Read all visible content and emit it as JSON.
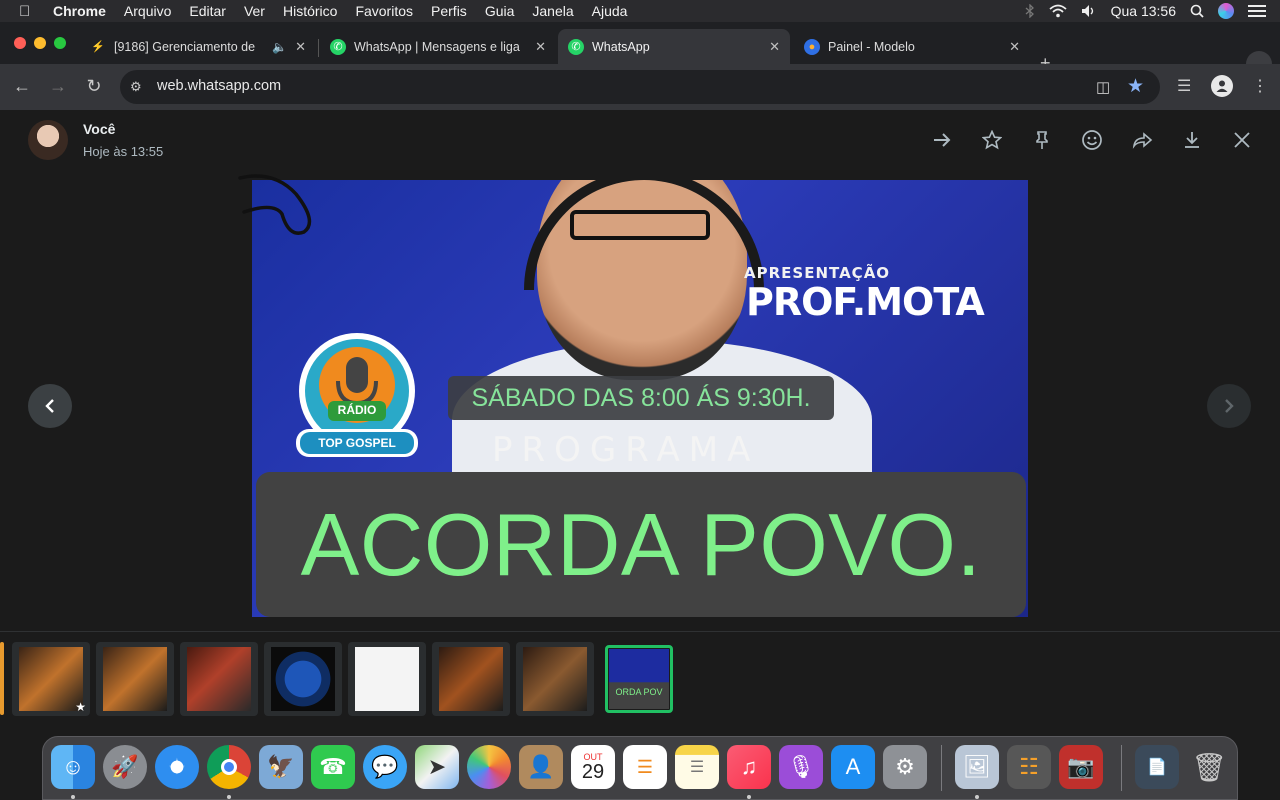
{
  "menubar": {
    "app": "Chrome",
    "items": [
      "Arquivo",
      "Editar",
      "Ver",
      "Histórico",
      "Favoritos",
      "Perfis",
      "Guia",
      "Janela",
      "Ajuda"
    ],
    "clock": "Qua 13:56"
  },
  "tabs": [
    {
      "title": "[9186] Gerenciamento de",
      "active": false
    },
    {
      "title": "WhatsApp | Mensagens e liga",
      "active": false
    },
    {
      "title": "WhatsApp",
      "active": true
    },
    {
      "title": "Painel - Modelo",
      "active": false
    }
  ],
  "toolbar": {
    "url": "web.whatsapp.com"
  },
  "viewer": {
    "sender": "Você",
    "timestamp": "Hoje às 13:55"
  },
  "image": {
    "apresentacao": "APRESENTAÇÃO",
    "name": "PROF.MOTA",
    "logo_radio": "RÁDIO",
    "logo_top": "TOP GOSPEL",
    "schedule": "SÁBADO DAS 8:00 ÁS 9:30H.",
    "programa": "PROGRAMA",
    "headline": "ACORDA POVO."
  },
  "thumbnails": {
    "count": 8,
    "selected_index": 7,
    "selected_caption": "ORDA POV"
  },
  "colors": {
    "whatsapp_green": "#21c063",
    "headline_green": "#7ff08a",
    "accent_blue": "#8ab4f8"
  },
  "dock": {
    "calendar_month": "OUT",
    "calendar_day": "29"
  }
}
